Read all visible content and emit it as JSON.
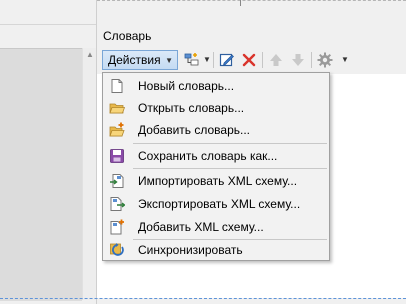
{
  "panel": {
    "title": "Словарь"
  },
  "toolbar": {
    "actions_label": "Действия",
    "icons": [
      "add-dictionary-icon",
      "edit-icon",
      "delete-icon",
      "move-up-icon",
      "move-down-icon",
      "settings-icon"
    ]
  },
  "menu": {
    "items": [
      {
        "label": "Новый словарь...",
        "icon": "new-document-icon"
      },
      {
        "label": "Открыть словарь...",
        "icon": "open-folder-icon"
      },
      {
        "label": "Добавить словарь...",
        "icon": "add-folder-icon"
      },
      {
        "label": "Сохранить словарь как...",
        "icon": "save-icon"
      },
      {
        "label": "Импортировать XML схему...",
        "icon": "import-xml-icon"
      },
      {
        "label": "Экспортировать XML схему...",
        "icon": "export-xml-icon"
      },
      {
        "label": "Добавить XML схему...",
        "icon": "add-xml-icon"
      },
      {
        "label": "Синхронизировать",
        "icon": "sync-icon"
      }
    ]
  }
}
